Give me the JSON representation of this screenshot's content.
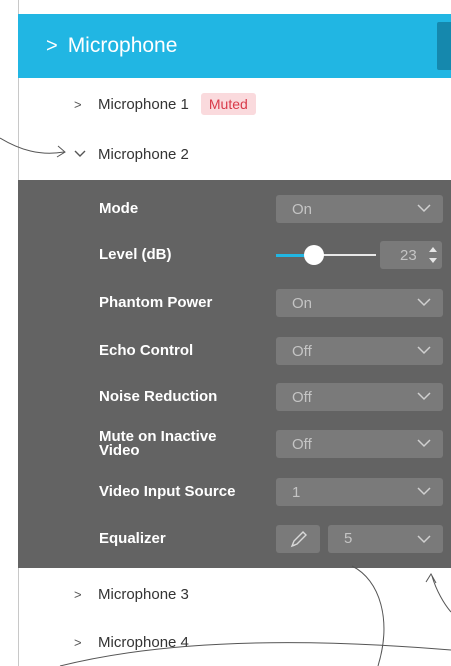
{
  "header": {
    "title": "Microphone"
  },
  "microphones": [
    {
      "label": "Microphone 1",
      "badge": "Muted"
    },
    {
      "label": "Microphone 2"
    },
    {
      "label": "Microphone 3"
    },
    {
      "label": "Microphone 4"
    }
  ],
  "settings": {
    "mode": {
      "label": "Mode",
      "value": "On"
    },
    "level": {
      "label": "Level (dB)",
      "value": "23",
      "fraction": 0.38
    },
    "phantom": {
      "label": "Phantom Power",
      "value": "On"
    },
    "echo": {
      "label": "Echo Control",
      "value": "Off"
    },
    "noise": {
      "label": "Noise Reduction",
      "value": "Off"
    },
    "mute_inactive": {
      "label": "Mute on Inactive Video",
      "value": "Off"
    },
    "video_source": {
      "label": "Video Input Source",
      "value": "1"
    },
    "equalizer": {
      "label": "Equalizer",
      "value": "5"
    }
  },
  "icons": {
    "expand": "chevron-right-icon",
    "collapse": "chevron-down-icon",
    "dropdown": "chevron-down-icon",
    "edit": "pencil-icon",
    "spinner": "stepper-icon"
  },
  "colors": {
    "header": "#21b6e3",
    "panel": "#636363",
    "control": "#7a7a7a",
    "badge_bg": "#fadadd",
    "badge_text": "#d93a4a"
  }
}
